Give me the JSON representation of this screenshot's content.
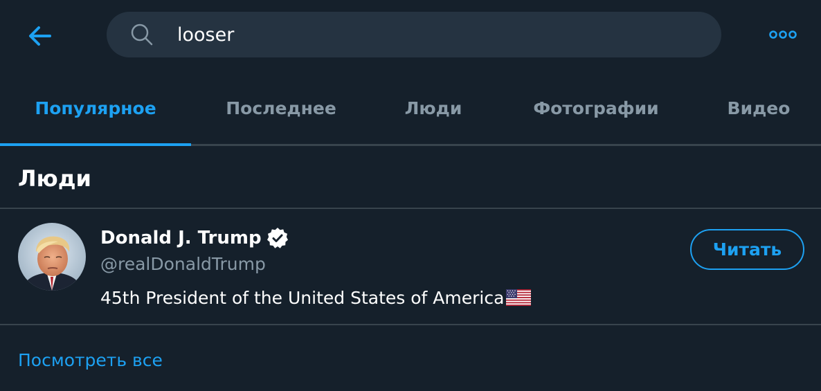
{
  "search": {
    "query": "looser",
    "icon": "search-icon"
  },
  "header": {
    "back_icon": "arrow-left-icon",
    "more_icon": "more-horizontal-icon"
  },
  "tabs": [
    {
      "label": "Популярное",
      "active": true
    },
    {
      "label": "Последнее",
      "active": false
    },
    {
      "label": "Люди",
      "active": false
    },
    {
      "label": "Фотографии",
      "active": false
    },
    {
      "label": "Видео",
      "active": false
    }
  ],
  "people_section": {
    "title": "Люди",
    "see_all_label": "Посмотреть все",
    "users": [
      {
        "name": "Donald J. Trump",
        "verified": true,
        "handle": "@realDonaldTrump",
        "bio": "45th President of the United States of America",
        "bio_emoji": "us-flag-icon",
        "follow_label": "Читать"
      }
    ]
  },
  "colors": {
    "background": "#15202b",
    "search_bg": "#253341",
    "accent": "#1da1f2",
    "muted_text": "#8899a6",
    "divider": "#38444d",
    "text": "#ffffff"
  }
}
